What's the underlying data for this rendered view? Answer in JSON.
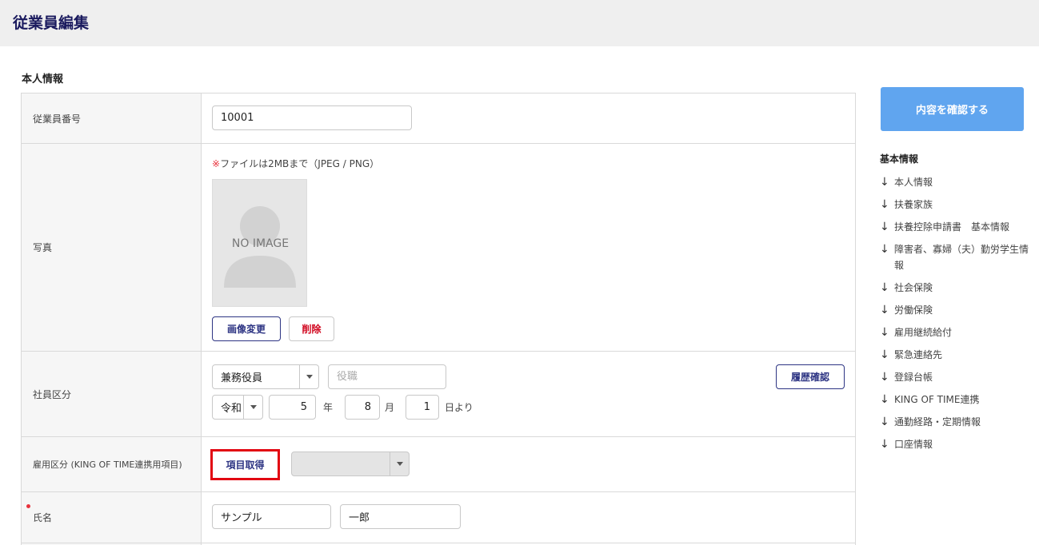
{
  "page": {
    "title": "従業員編集"
  },
  "section": {
    "title": "本人情報"
  },
  "fields": {
    "employee_number": {
      "label": "従業員番号",
      "value": "10001"
    },
    "photo": {
      "label": "写真",
      "note_mark": "※",
      "note_text": "ファイルは2MBまで（JPEG / PNG）",
      "placeholder_text": "NO IMAGE",
      "change_button": "画像変更",
      "delete_button": "削除"
    },
    "employee_type": {
      "label": "社員区分",
      "type_value": "兼務役員",
      "position_placeholder": "役職",
      "history_button": "履歴確認",
      "era_value": "令和",
      "year_value": "5",
      "year_unit": "年",
      "month_value": "8",
      "month_unit": "月",
      "day_value": "1",
      "day_unit": "日より"
    },
    "employment_category": {
      "label": "雇用区分 (KING OF TIME連携用項目)",
      "fetch_button": "項目取得",
      "select_value": ""
    },
    "name": {
      "label": "氏名",
      "last_name": "サンプル",
      "first_name": "一郎"
    }
  },
  "actions": {
    "confirm_button": "内容を確認する"
  },
  "side_nav": {
    "title": "基本情報",
    "arrow": "↓",
    "items": [
      "本人情報",
      "扶養家族",
      "扶養控除申請書　基本情報",
      "障害者、寡婦（夫）勤労学生情報",
      "社会保険",
      "労働保険",
      "雇用継続給付",
      "緊急連絡先",
      "登録台帳",
      "KING OF TIME連携",
      "通勤経路・定期情報",
      "口座情報"
    ]
  },
  "colors": {
    "title_navy": "#1a1a5e",
    "button_navy": "#2d3483",
    "accent_blue": "#60a5ef",
    "highlight_red": "#e20612",
    "required_red": "#e8323c"
  }
}
